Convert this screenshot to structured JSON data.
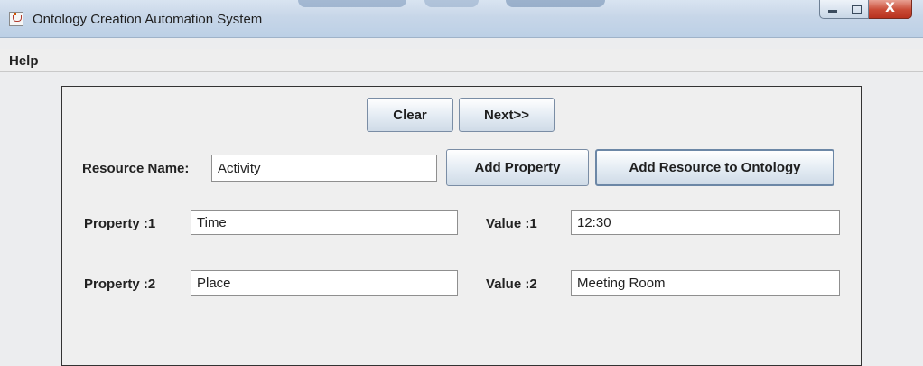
{
  "window": {
    "title": "Ontology Creation Automation System",
    "icon": "java-cup-icon",
    "controls": [
      "minimize-icon",
      "maximize-icon",
      "close-icon"
    ]
  },
  "menu": {
    "items": [
      {
        "label": "Help"
      }
    ]
  },
  "toolbar": {
    "clear_label": "Clear",
    "next_label": "Next>>"
  },
  "resource": {
    "label": "Resource Name:",
    "value": "Activity",
    "add_property_label": "Add Property",
    "add_resource_label": "Add Resource to Ontology"
  },
  "properties": [
    {
      "property_label": "Property :1",
      "property_value": "Time",
      "value_label": "Value :1",
      "value_value": "12:30"
    },
    {
      "property_label": "Property :2",
      "property_value": "Place",
      "value_label": "Value :2",
      "value_value": "Meeting Room"
    }
  ],
  "colors": {
    "titlebar": "#c7d6e8",
    "close_button": "#c94a35",
    "panel_background": "#efefef"
  }
}
